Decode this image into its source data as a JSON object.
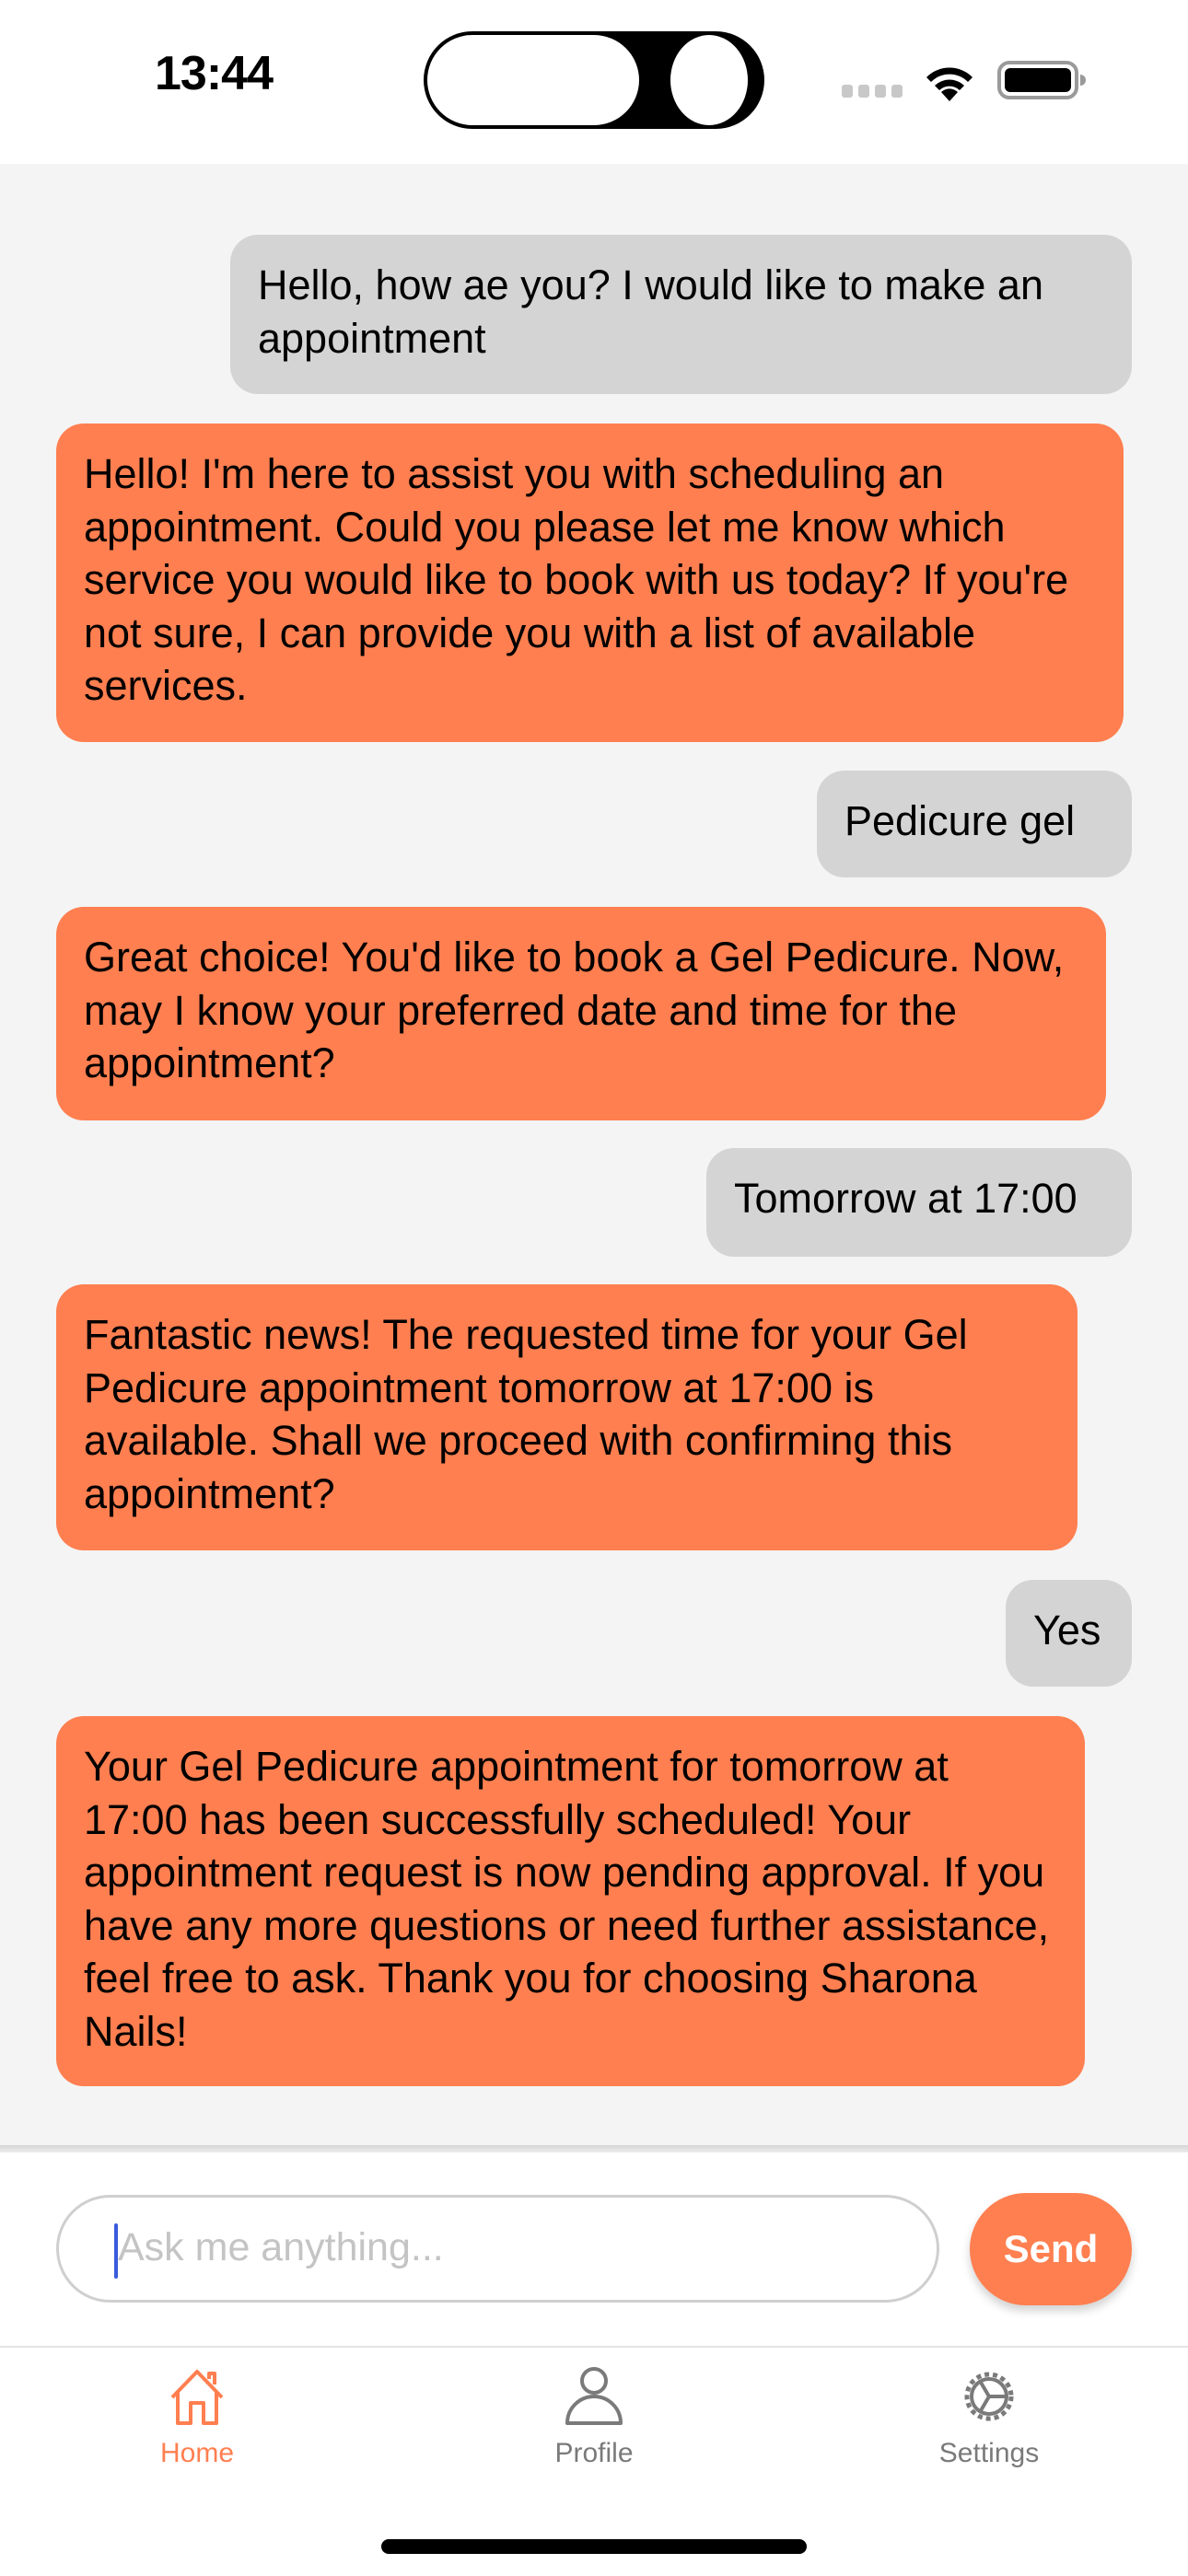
{
  "status_bar": {
    "time": "13:44",
    "icons": [
      "signal-dots-icon",
      "wifi-icon",
      "battery-icon"
    ]
  },
  "colors": {
    "accent": "#FF7F50",
    "user_bubble": "#D4D4D4",
    "chat_background": "#F4F4F4",
    "tab_inactive": "#7A7A7A",
    "caret": "#3A5BDC"
  },
  "messages": [
    {
      "sender": "user",
      "text": "Hello, how ae you? I would like to make an appointment"
    },
    {
      "sender": "bot",
      "text": "Hello! I'm here to assist you with scheduling an appointment. Could you please let me know which service you would like to book with us today? If you're not sure, I can provide you with a list of available services."
    },
    {
      "sender": "user",
      "text": "Pedicure gel"
    },
    {
      "sender": "bot",
      "text": "Great choice! You'd like to book a Gel Pedicure. Now, may I know your preferred date and time for the appointment?"
    },
    {
      "sender": "user",
      "text": "Tomorrow at 17:00"
    },
    {
      "sender": "bot",
      "text": "Fantastic news! The requested time for your Gel Pedicure appointment tomorrow at 17:00 is available. Shall we proceed with confirming this appointment?"
    },
    {
      "sender": "user",
      "text": "Yes"
    },
    {
      "sender": "bot",
      "text": "Your Gel Pedicure appointment for tomorrow at 17:00 has been successfully scheduled! Your appointment request is now pending approval. If you have any more questions or need further assistance, feel free to ask. Thank you for choosing Sharona Nails!"
    }
  ],
  "composer": {
    "value": "",
    "placeholder": "Ask me anything...",
    "send_label": "Send"
  },
  "tabbar": {
    "items": [
      {
        "label": "Home",
        "icon": "home-icon",
        "active": true
      },
      {
        "label": "Profile",
        "icon": "profile-icon",
        "active": false
      },
      {
        "label": "Settings",
        "icon": "settings-icon",
        "active": false
      }
    ]
  }
}
